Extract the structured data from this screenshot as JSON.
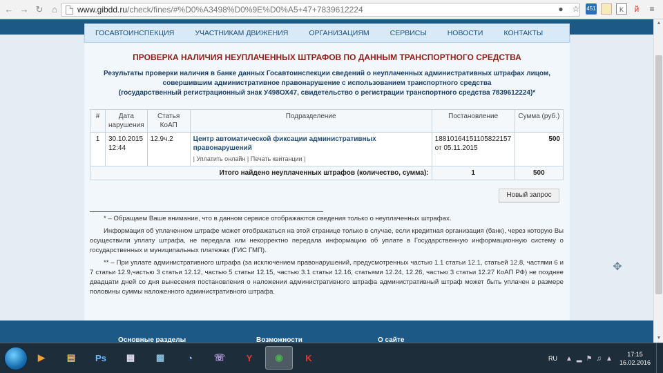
{
  "browser": {
    "url_host": "www.gibdd.ru",
    "url_path": "/check/fines/#%D0%A3498%D0%9E%D0%A5+47+7839612224"
  },
  "nav": {
    "items": [
      {
        "label": "ГОСАВТОИНСПЕКЦИЯ"
      },
      {
        "label": "УЧАСТНИКАМ ДВИЖЕНИЯ"
      },
      {
        "label": "ОРГАНИЗАЦИЯМ"
      },
      {
        "label": "СЕРВИСЫ"
      },
      {
        "label": "НОВОСТИ"
      },
      {
        "label": "КОНТАКТЫ"
      }
    ]
  },
  "main": {
    "title": "ПРОВЕРКА НАЛИЧИЯ НЕУПЛАЧЕННЫХ ШТРАФОВ ПО ДАННЫМ ТРАНСПОРТНОГО СРЕДСТВА",
    "result_line1": "Результаты проверки наличия в банке данных Госавтоинспекции сведений о неуплаченных административных штрафах лицом,",
    "result_line2": "совершившим административное правонарушение с использованием транспортного средства",
    "result_line3": "(государственный регистрационный знак У498ОХ47, свидетельство о регистрации транспортного средства 7839612224)*"
  },
  "table": {
    "headers": {
      "num": "#",
      "date": "Дата нарушения",
      "article": "Статья КоАП",
      "dept": "Подразделение",
      "resolution": "Постановление",
      "sum": "Сумма (руб.)"
    },
    "rows": [
      {
        "num": "1",
        "date": "30.10.2015 12:44",
        "article": "12.9ч.2",
        "dept": "Центр автоматической фиксации административных правонарушений",
        "links": "| Уплатить онлайн | Печать квитанции |",
        "resolution": "18810164151105822157 от 05.11.2015",
        "sum": "500"
      }
    ],
    "total_label": "Итого найдено неуплаченных штрафов (количество, сумма):",
    "total_count": "1",
    "total_sum": "500"
  },
  "buttons": {
    "new_request": "Новый запрос"
  },
  "footnotes": {
    "note1": "* – Обращаем Ваше внимание, что в данном сервисе отображаются сведения только о неуплаченных штрафах.",
    "note2": "Информация об уплаченном штрафе может отображаться на этой странице только в случае, если кредитная организация (банк), через которую Вы осуществили уплату штрафа, не передала или некорректно передала информацию об уплате в Государственную информационную систему о государственных и муниципальных платежах (ГИС ГМП).",
    "note3": "** – При уплате административного штрафа (за исключением правонарушений, предусмотренных частью 1.1 статьи 12.1, статьей 12.8, частями 6 и 7 статьи 12.9,частью 3 статьи 12.12, частью 5 статьи 12.15, частью 3.1 статьи 12.16, статьями 12.24, 12.26, частью 3 статьи 12.27 КоАП РФ) не позднее двадцати дней со дня вынесения постановления о наложении административного штрафа административный штраф может быть уплачен в размере половины суммы наложенного административного штрафа."
  },
  "footer": {
    "col1": "Основные разделы",
    "col2": "Возможности",
    "col3": "О сайте"
  },
  "taskbar": {
    "lang": "RU",
    "time": "17:15",
    "date": "16.02.2016"
  }
}
